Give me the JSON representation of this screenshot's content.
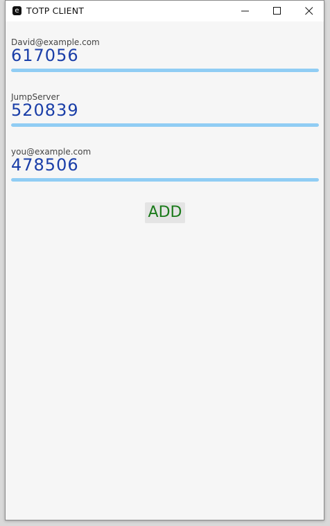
{
  "window": {
    "icon_letter": "e",
    "title": "TOTP CLIENT"
  },
  "accounts": [
    {
      "label": "David@example.com",
      "code": "617056",
      "progress": 1.0
    },
    {
      "label": "JumpServer",
      "code": "520839",
      "progress": 1.0
    },
    {
      "label": "you@example.com",
      "code": "478506",
      "progress": 1.0
    }
  ],
  "add_button_label": "ADD",
  "colors": {
    "code": "#1a3ea8",
    "progress": "#90cdf4",
    "add_label": "#1a7a1a"
  }
}
